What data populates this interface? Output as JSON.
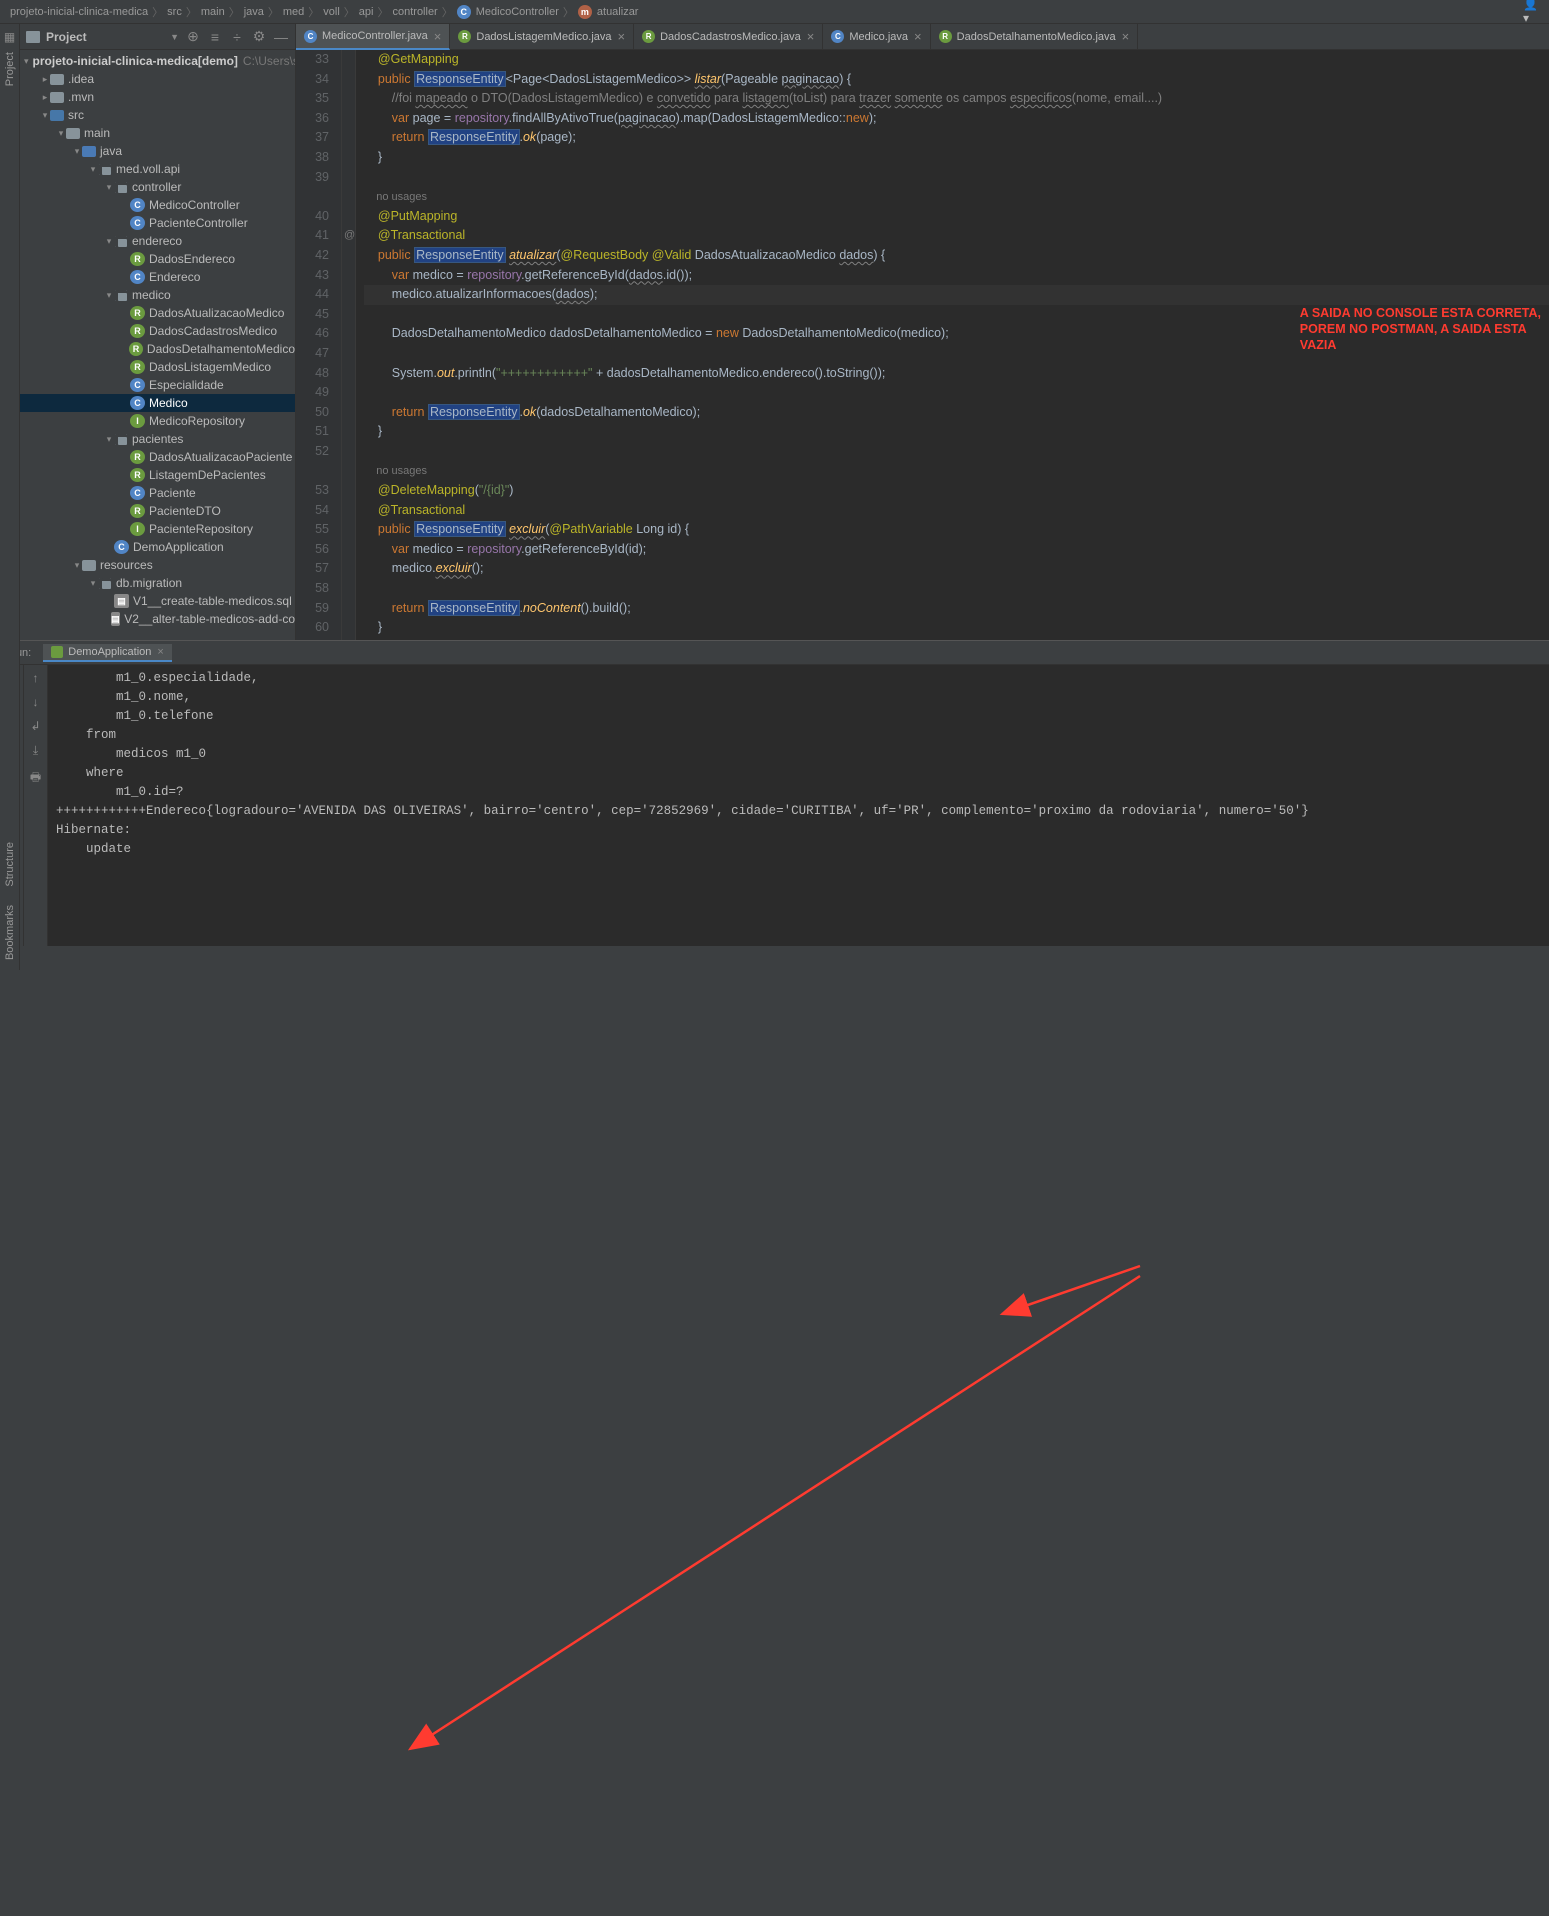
{
  "breadcrumb": [
    "projeto-inicial-clinica-medica",
    "src",
    "main",
    "java",
    "med",
    "voll",
    "api",
    "controller",
    "MedicoController",
    "atualizar"
  ],
  "project_panel": {
    "title": "Project",
    "root": {
      "name": "projeto-inicial-clinica-medica",
      "badge": "[demo]",
      "path": "C:\\Users\\s"
    },
    "nodes": [
      {
        "indent": 1,
        "arrow": ">",
        "type": "folder",
        "name": ".idea"
      },
      {
        "indent": 1,
        "arrow": ">",
        "type": "folder",
        "name": ".mvn"
      },
      {
        "indent": 1,
        "arrow": "v",
        "type": "folder src",
        "name": "src"
      },
      {
        "indent": 2,
        "arrow": "v",
        "type": "folder",
        "name": "main"
      },
      {
        "indent": 3,
        "arrow": "v",
        "type": "folder blue",
        "name": "java"
      },
      {
        "indent": 4,
        "arrow": "v",
        "type": "pkg",
        "name": "med.voll.api"
      },
      {
        "indent": 5,
        "arrow": "v",
        "type": "pkg",
        "name": "controller"
      },
      {
        "indent": 6,
        "arrow": "",
        "type": "cls",
        "name": "MedicoController"
      },
      {
        "indent": 6,
        "arrow": "",
        "type": "cls",
        "name": "PacienteController"
      },
      {
        "indent": 5,
        "arrow": "v",
        "type": "pkg",
        "name": "endereco"
      },
      {
        "indent": 6,
        "arrow": "",
        "type": "rec",
        "name": "DadosEndereco"
      },
      {
        "indent": 6,
        "arrow": "",
        "type": "cls",
        "name": "Endereco"
      },
      {
        "indent": 5,
        "arrow": "v",
        "type": "pkg",
        "name": "medico"
      },
      {
        "indent": 6,
        "arrow": "",
        "type": "rec",
        "name": "DadosAtualizacaoMedico"
      },
      {
        "indent": 6,
        "arrow": "",
        "type": "rec",
        "name": "DadosCadastrosMedico"
      },
      {
        "indent": 6,
        "arrow": "",
        "type": "rec",
        "name": "DadosDetalhamentoMedico"
      },
      {
        "indent": 6,
        "arrow": "",
        "type": "rec",
        "name": "DadosListagemMedico"
      },
      {
        "indent": 6,
        "arrow": "",
        "type": "cls",
        "name": "Especialidade"
      },
      {
        "indent": 6,
        "arrow": "",
        "type": "cls",
        "name": "Medico",
        "selected": true
      },
      {
        "indent": 6,
        "arrow": "",
        "type": "intf",
        "name": "MedicoRepository"
      },
      {
        "indent": 5,
        "arrow": "v",
        "type": "pkg",
        "name": "pacientes"
      },
      {
        "indent": 6,
        "arrow": "",
        "type": "rec",
        "name": "DadosAtualizacaoPaciente"
      },
      {
        "indent": 6,
        "arrow": "",
        "type": "rec",
        "name": "ListagemDePacientes"
      },
      {
        "indent": 6,
        "arrow": "",
        "type": "cls",
        "name": "Paciente"
      },
      {
        "indent": 6,
        "arrow": "",
        "type": "rec",
        "name": "PacienteDTO"
      },
      {
        "indent": 6,
        "arrow": "",
        "type": "intf",
        "name": "PacienteRepository"
      },
      {
        "indent": 5,
        "arrow": "",
        "type": "cls",
        "name": "DemoApplication"
      },
      {
        "indent": 3,
        "arrow": "v",
        "type": "folder",
        "name": "resources"
      },
      {
        "indent": 4,
        "arrow": "v",
        "type": "pkg",
        "name": "db.migration"
      },
      {
        "indent": 5,
        "arrow": "",
        "type": "sql",
        "name": "V1__create-table-medicos.sql"
      },
      {
        "indent": 5,
        "arrow": "",
        "type": "sql",
        "name": "V2__alter-table-medicos-add-co"
      }
    ]
  },
  "tabs": [
    {
      "icon": "c",
      "label": "MedicoController.java",
      "active": true
    },
    {
      "icon": "r",
      "label": "DadosListagemMedico.java"
    },
    {
      "icon": "r",
      "label": "DadosCadastrosMedico.java"
    },
    {
      "icon": "c",
      "label": "Medico.java"
    },
    {
      "icon": "r",
      "label": "DadosDetalhamentoMedico.java"
    }
  ],
  "code": {
    "first_line": 33,
    "lines": [
      "    @GetMapping",
      "    public ResponseEntity<Page<DadosListagemMedico>> listar(Pageable paginacao) {",
      "        //foi mapeado o DTO(DadosListagemMedico) e convetido para listagem(toList) para trazer somente os campos especificos(nome, email....)",
      "        var page = repository.findAllByAtivoTrue(paginacao).map(DadosListagemMedico::new);",
      "        return ResponseEntity.ok(page);",
      "    }",
      "",
      "    no usages",
      "    @PutMapping",
      "    @Transactional",
      "    public ResponseEntity atualizar(@RequestBody @Valid DadosAtualizacaoMedico dados) {",
      "        var medico = repository.getReferenceById(dados.id());",
      "        medico.atualizarInformacoes(dados);",
      "",
      "        DadosDetalhamentoMedico dadosDetalhamentoMedico = new DadosDetalhamentoMedico(medico);",
      "",
      "        System.out.println(\"++++++++++++\" + dadosDetalhamentoMedico.endereco().toString());",
      "",
      "        return ResponseEntity.ok(dadosDetalhamentoMedico);",
      "    }",
      "",
      "    no usages",
      "    @DeleteMapping(\"/{id}\")",
      "    @Transactional",
      "    public ResponseEntity excluir(@PathVariable Long id) {",
      "        var medico = repository.getReferenceById(id);",
      "        medico.excluir();",
      "",
      "        return ResponseEntity.noContent().build();",
      "    }"
    ]
  },
  "run": {
    "label": "Run:",
    "tab": "DemoApplication",
    "lines": [
      "        m1_0.especialidade,",
      "        m1_0.nome,",
      "        m1_0.telefone ",
      "    from",
      "        medicos m1_0 ",
      "    where",
      "        m1_0.id=?",
      "++++++++++++Endereco{logradouro='AVENIDA DAS OLIVEIRAS', bairro='centro', cep='72852969', cidade='CURITIBA', uf='PR', complemento='proximo da rodoviaria', numero='50'}",
      "Hibernate: ",
      "    update"
    ]
  },
  "annotation": {
    "l1": "A SAIDA NO CONSOLE ESTA CORRETA,",
    "l2": "POREM NO POSTMAN, A SAIDA ESTA",
    "l3": "VAZIA"
  },
  "left_tools": {
    "structure": "Structure",
    "bookmarks": "Bookmarks",
    "project": "Project"
  }
}
